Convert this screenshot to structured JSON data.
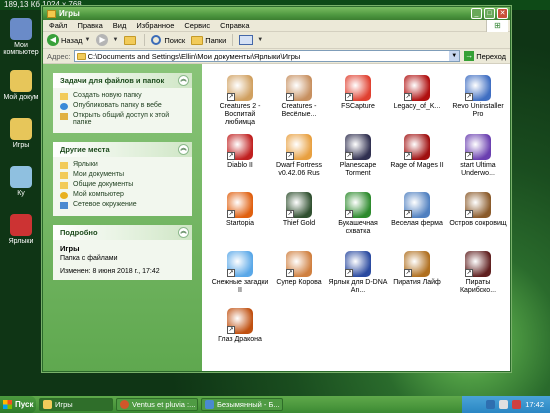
{
  "info_bar": "189,13 Кб 1024 х 768",
  "desktop": {
    "icons": [
      {
        "label": "Мои компьютер",
        "color": "#6a8bc8",
        "icon": "computer-icon"
      },
      {
        "label": "Мой докум",
        "color": "#e7c65a",
        "icon": "documents-icon"
      },
      {
        "label": "Игры",
        "color": "#e7c65a",
        "icon": "folder-icon"
      },
      {
        "label": "Ку",
        "color": "#8fc0e0",
        "icon": "app-icon"
      },
      {
        "label": "Ярлыки",
        "color": "#cc3333",
        "icon": "shortcut-icon"
      }
    ]
  },
  "window": {
    "title": "Игры",
    "menu": [
      "Файл",
      "Правка",
      "Вид",
      "Избранное",
      "Сервис",
      "Справка"
    ],
    "toolbar": {
      "back": "Назад",
      "search": "Поиск",
      "folders": "Папки"
    },
    "address_label": "Адрес:",
    "address": "C:\\Documents and Settings\\Ellin\\Мои документы\\Ярлыки\\Игры",
    "go": "Переход"
  },
  "tasks_panel": {
    "title": "Задачи для файлов и папок",
    "items": [
      "Создать новую папку",
      "Опубликовать папку в вебе",
      "Открыть общий доступ к этой папке"
    ]
  },
  "places_panel": {
    "title": "Другие места",
    "items": [
      "Ярлыки",
      "Мои документы",
      "Общие документы",
      "Мой компьютер",
      "Сетевое окружение"
    ]
  },
  "details_panel": {
    "title": "Подробно",
    "name": "Игры",
    "type": "Папка с файлами",
    "modified": "Изменен: 8 июня 2018 г., 17:42"
  },
  "files": [
    {
      "label": "Creatures 2 - Воспитай любимца",
      "color": "#d0a060",
      "icon": "creatures-icon"
    },
    {
      "label": "Creatures - Весёлые...",
      "color": "#c79060",
      "icon": "creatures-icon"
    },
    {
      "label": "FSCapture",
      "color": "#e04030",
      "icon": "fscapture-icon"
    },
    {
      "label": "Legacy_of_K...",
      "color": "#b01010",
      "icon": "legacy-icon"
    },
    {
      "label": "Revo Uninstaller Pro",
      "color": "#3f6ec2",
      "icon": "revo-icon"
    },
    {
      "label": "Diablo II",
      "color": "#c02020",
      "icon": "diablo-icon"
    },
    {
      "label": "Dwarf Fortress v0.42.06 Rus",
      "color": "#e8a040",
      "icon": "dwarf-fortress-icon"
    },
    {
      "label": "Planescape Torment",
      "color": "#303050",
      "icon": "planescape-icon"
    },
    {
      "label": "Rage of Mages II",
      "color": "#a01010",
      "icon": "rage-of-mages-icon"
    },
    {
      "label": "start Ultima Underwo...",
      "color": "#6a3fb0",
      "icon": "ultima-icon"
    },
    {
      "label": "Startopia",
      "color": "#e06010",
      "icon": "startopia-icon"
    },
    {
      "label": "Thief Gold",
      "color": "#305030",
      "icon": "thief-icon"
    },
    {
      "label": "Букашечная схватка",
      "color": "#2c8a2c",
      "icon": "bug-icon"
    },
    {
      "label": "Веселая ферма",
      "color": "#5080c0",
      "icon": "farm-icon"
    },
    {
      "label": "Остров сокровищ",
      "color": "#8a5a2a",
      "icon": "island-icon"
    },
    {
      "label": "Снежные загадки II",
      "color": "#5aa8e8",
      "icon": "snow-icon"
    },
    {
      "label": "Супер Корова",
      "color": "#d08040",
      "icon": "cow-icon"
    },
    {
      "label": "Ярлык для D-DNA An...",
      "color": "#2a4aa0",
      "icon": "dna-icon"
    },
    {
      "label": "Пиратия Лайф",
      "color": "#b07020",
      "icon": "pirate-icon"
    },
    {
      "label": "Пираты Карибско...",
      "color": "#602020",
      "icon": "pirates-icon"
    },
    {
      "label": "Глаз Дракона",
      "color": "#c05010",
      "icon": "dragon-eye-icon"
    }
  ],
  "taskbar": {
    "start": "Пуск",
    "tasks": [
      {
        "label": "Игры",
        "color": "#f2cb5a",
        "icon": "folder-icon"
      },
      {
        "label": "Ventus et pluvia :...",
        "color": "#d0562a",
        "icon": "browser-icon"
      },
      {
        "label": "Безымянный - Б...",
        "color": "#4a8ad0",
        "icon": "paint-icon"
      }
    ],
    "clock": "17:42"
  }
}
